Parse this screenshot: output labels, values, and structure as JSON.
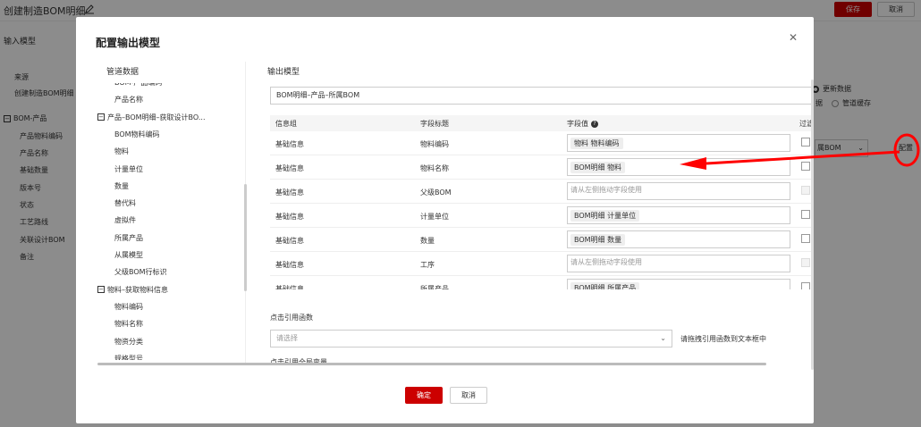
{
  "background": {
    "title": "创建制造BOM明细",
    "save_label": "保存",
    "cancel_label": "取消",
    "section": "输入模型",
    "items": [
      "来源",
      "创建制造BOM明细",
      "BOM-产品",
      "产品物料编码",
      "产品名称",
      "基础数量",
      "版本号",
      "状态",
      "工艺路线",
      "关联设计BOM",
      "备注"
    ],
    "radio_update": "更新数据",
    "radio_cache": "管道缓存",
    "radio_partial": "据",
    "select_partial": "属BOM",
    "config_link": "配置"
  },
  "modal": {
    "title": "配置输出模型",
    "close_icon": "close-icon",
    "left": {
      "title": "管道数据",
      "tree": [
        {
          "label": "BOM-产品编码",
          "indent": 1
        },
        {
          "label": "产品名称",
          "indent": 1
        },
        {
          "label": "产品–BOM明细–获取设计BO...",
          "indent": 0,
          "group": true
        },
        {
          "label": "BOM物料编码",
          "indent": 1
        },
        {
          "label": "物料",
          "indent": 1
        },
        {
          "label": "计量单位",
          "indent": 1
        },
        {
          "label": "数量",
          "indent": 1
        },
        {
          "label": "替代料",
          "indent": 1
        },
        {
          "label": "虚拟件",
          "indent": 1
        },
        {
          "label": "所属产品",
          "indent": 1
        },
        {
          "label": "从属模型",
          "indent": 1
        },
        {
          "label": "父级BOM行标识",
          "indent": 1
        },
        {
          "label": "物料–获取物料信息",
          "indent": 0,
          "group": true
        },
        {
          "label": "物料编码",
          "indent": 1
        },
        {
          "label": "物料名称",
          "indent": 1
        },
        {
          "label": "物资分类",
          "indent": 1
        },
        {
          "label": "规格型号",
          "indent": 1
        }
      ]
    },
    "right": {
      "title": "输出模型",
      "output_value": "BOM明细–产品–所属BOM",
      "columns": [
        "信息组",
        "字段标题",
        "字段值",
        "过滤"
      ],
      "rows": [
        {
          "group": "基础信息",
          "field": "物料编码",
          "value": "物料 物料编码",
          "placeholder": "",
          "checkbox_disabled": false
        },
        {
          "group": "基础信息",
          "field": "物料名称",
          "value": "BOM明细 物料",
          "placeholder": "",
          "checkbox_disabled": false
        },
        {
          "group": "基础信息",
          "field": "父级BOM",
          "value": "",
          "placeholder": "请从左侧拖动字段使用",
          "checkbox_disabled": true
        },
        {
          "group": "基础信息",
          "field": "计量单位",
          "value": "BOM明细 计量单位",
          "placeholder": "",
          "checkbox_disabled": false
        },
        {
          "group": "基础信息",
          "field": "数量",
          "value": "BOM明细 数量",
          "placeholder": "",
          "checkbox_disabled": false
        },
        {
          "group": "基础信息",
          "field": "工序",
          "value": "",
          "placeholder": "请从左侧拖动字段使用",
          "checkbox_disabled": true
        },
        {
          "group": "基础信息",
          "field": "所属产品",
          "value": "BOM明细 所属产品",
          "placeholder": "",
          "checkbox_disabled": false
        }
      ],
      "func_label": "点击引用函数",
      "func_placeholder": "请选择",
      "func_hint": "请拖拽引用函数到文本框中",
      "global_label": "点击引用全局变量"
    },
    "confirm_label": "确定",
    "cancel_label": "取消"
  },
  "colors": {
    "primary": "#cc0000",
    "annotation": "#ff0000"
  }
}
